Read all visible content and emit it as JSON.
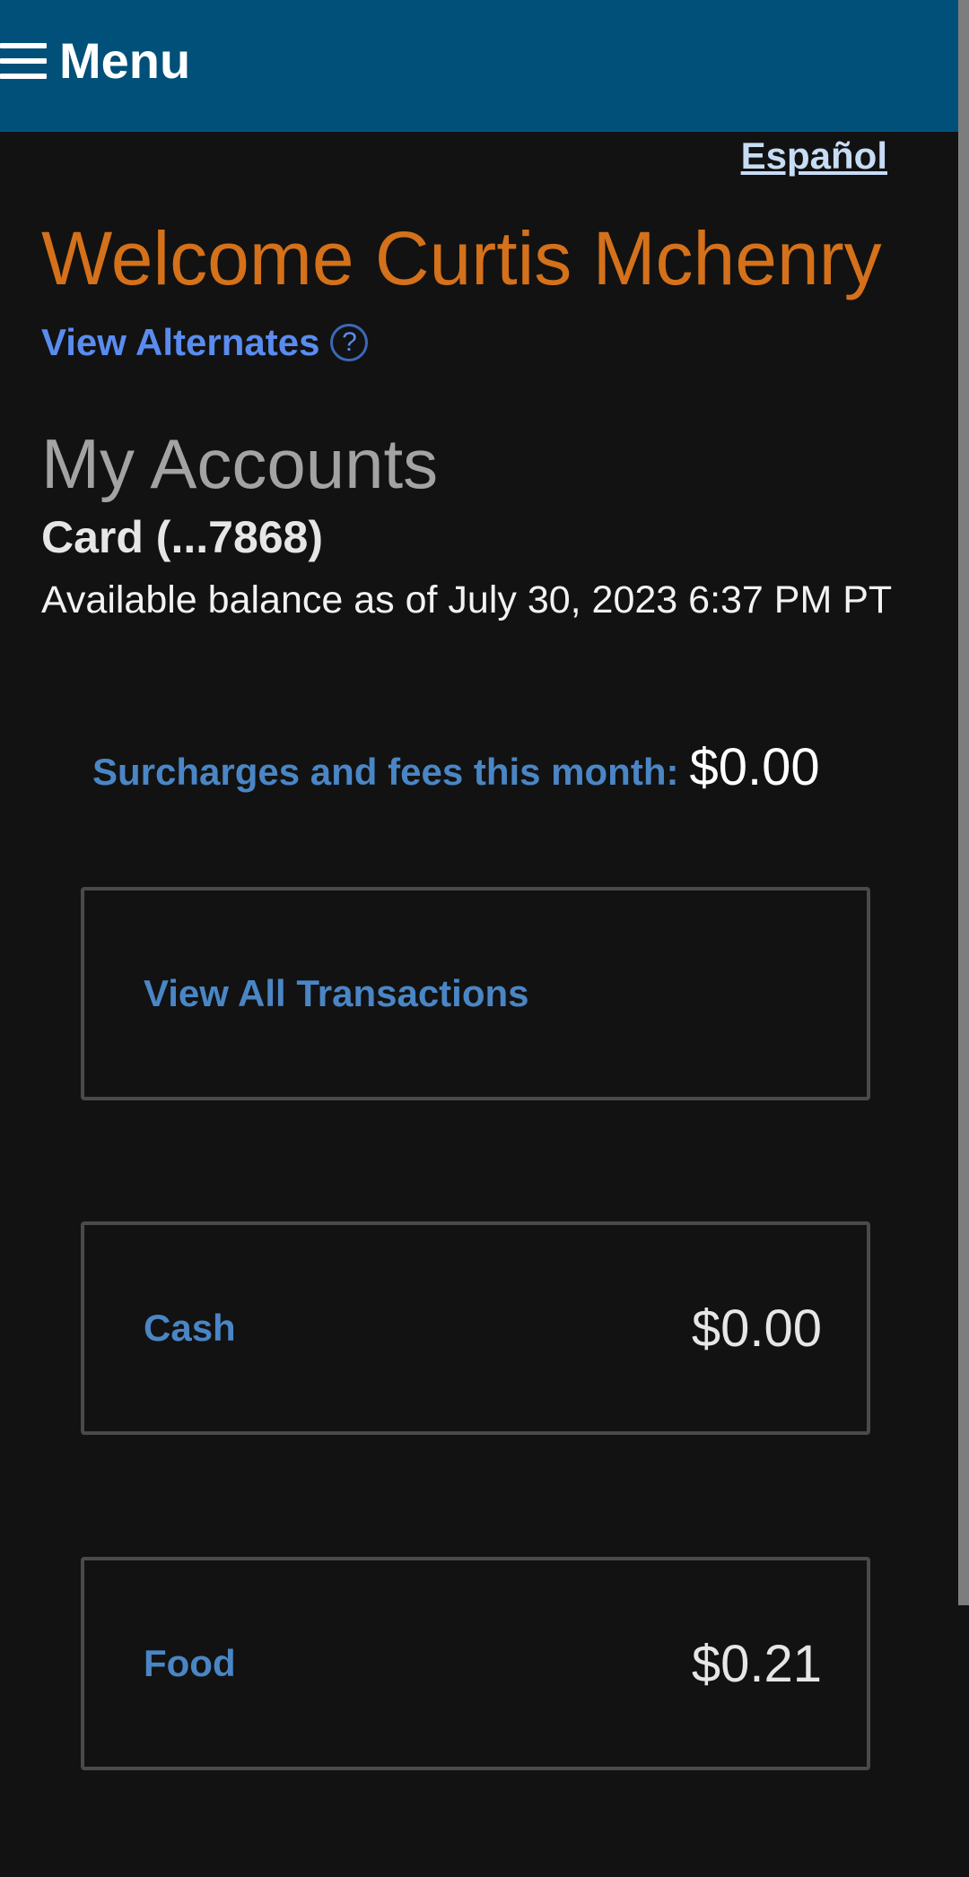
{
  "header": {
    "menu_label": "Menu",
    "menu_icon": "hamburger-icon",
    "background_color": "#005079"
  },
  "language_link": "Español",
  "welcome": "Welcome Curtis Mchenry",
  "view_alternates": {
    "label": "View Alternates",
    "help_glyph": "?"
  },
  "accounts": {
    "heading": "My Accounts",
    "card": "Card (...7868)",
    "balance_note": "Available balance as of July 30, 2023 6:37 PM PT",
    "fees": {
      "label": "Surcharges and fees this month:",
      "value": "$0.00"
    },
    "transactions_label": "View All Transactions",
    "balances": [
      {
        "label": "Cash",
        "amount": "$0.00"
      },
      {
        "label": "Food",
        "amount": "$0.21"
      }
    ]
  },
  "colors": {
    "accent_orange": "#d4711a",
    "link_blue": "#4a86c5",
    "page_background": "#121212"
  }
}
